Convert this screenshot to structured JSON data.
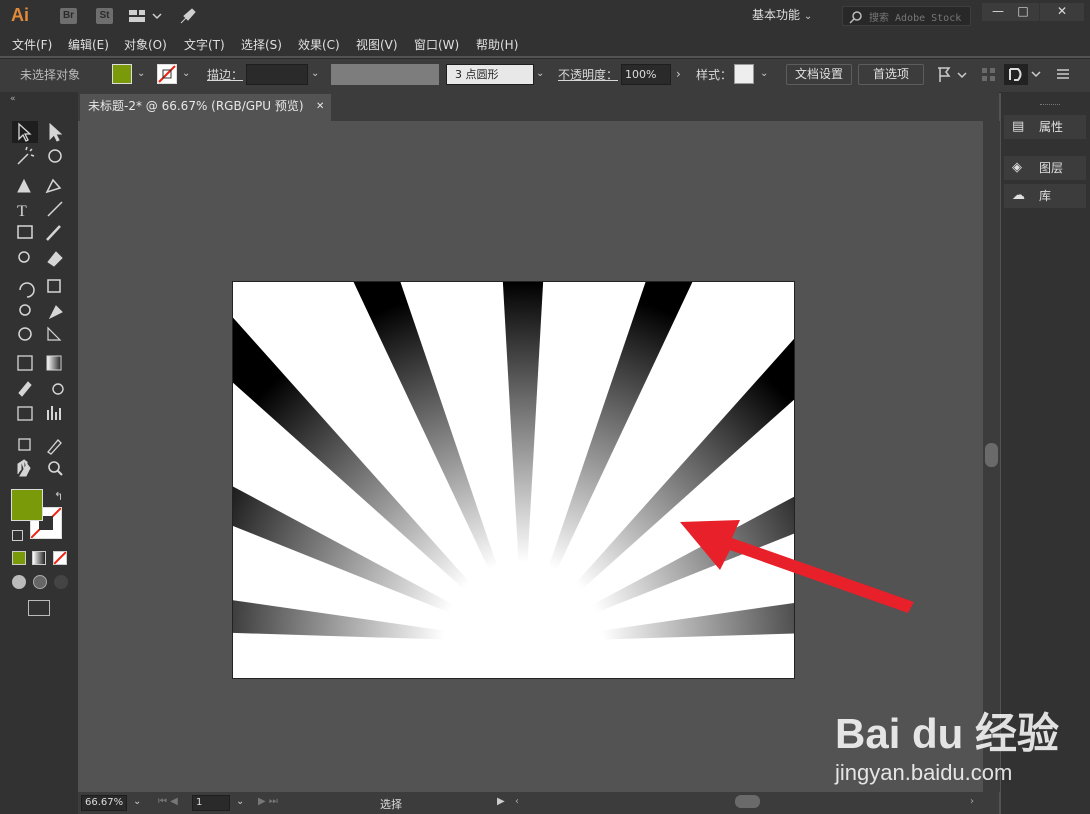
{
  "app": {
    "logo": "Ai",
    "br": "Br",
    "st": "St"
  },
  "workspace": {
    "label": "基本功能"
  },
  "stock_search": {
    "placeholder": "搜索 Adobe Stock"
  },
  "window_controls": {
    "minimize": "—",
    "maximize": "□",
    "close": "✕"
  },
  "menu": [
    "文件(F)",
    "编辑(E)",
    "对象(O)",
    "文字(T)",
    "选择(S)",
    "效果(C)",
    "视图(V)",
    "窗口(W)",
    "帮助(H)"
  ],
  "control": {
    "selection_status": "未选择对象",
    "stroke_label": "描边：",
    "brush_label": "3 点圆形",
    "opacity_label": "不透明度：",
    "opacity_value": "100%",
    "style_label": "样式：",
    "doc_setup": "文档设置",
    "preferences": "首选项",
    "fill_color": "#7a9a0a"
  },
  "document_tab": {
    "title": "未标题-2* @ 66.67% (RGB/GPU 预览)",
    "close": "✕"
  },
  "right_panels": [
    {
      "label": "属性",
      "icon": "properties-icon"
    },
    {
      "label": "图层",
      "icon": "layers-icon"
    },
    {
      "label": "库",
      "icon": "libraries-icon"
    }
  ],
  "status": {
    "zoom": "66.67%",
    "artboard_number": "1",
    "tool": "选择"
  },
  "watermark": {
    "brand": "Bai du 经验",
    "url": "jingyan.baidu.com"
  },
  "colors": {
    "accent_fill": "#7a9a0a",
    "arrow": "#e8202a"
  }
}
